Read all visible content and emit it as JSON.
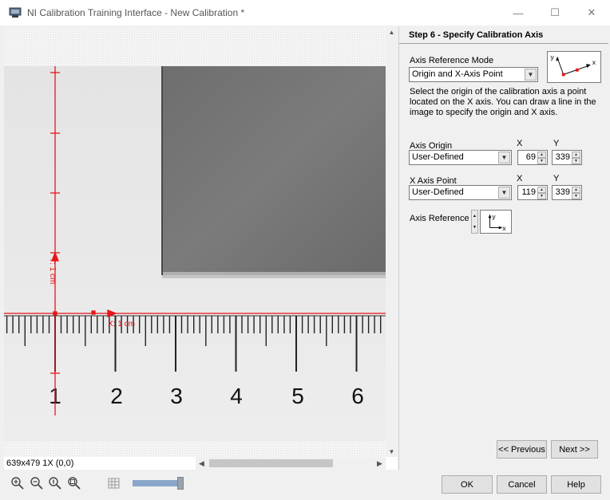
{
  "window": {
    "title": "NI Calibration Training Interface - New Calibration *",
    "minimize_glyph": "—",
    "maximize_glyph": "☐",
    "close_glyph": "✕"
  },
  "viewer": {
    "ruler_labels": [
      "1",
      "2",
      "3",
      "4",
      "5",
      "6"
    ],
    "y_axis_label": "Y: 1 cm",
    "x_axis_label": "X: 1 cm",
    "status": "639x479 1X   (0,0)",
    "axis_color": "#e8151b"
  },
  "panel": {
    "header": "Step 6 - Specify Calibration Axis",
    "axis_reference_mode_label": "Axis Reference Mode",
    "axis_reference_mode_value": "Origin and X-Axis Point",
    "description": "Select the origin of the calibration axis a point located on the X axis. You can draw a line in the image to specify the origin and X axis.",
    "axis_origin": {
      "label": "Axis Origin",
      "mode": "User-Defined",
      "x_header": "X",
      "y_header": "Y",
      "x": "69",
      "y": "339"
    },
    "x_axis_point": {
      "label": "X Axis Point",
      "mode": "User-Defined",
      "x_header": "X",
      "y_header": "Y",
      "x": "119",
      "y": "339"
    },
    "axis_reference_label": "Axis Reference",
    "preview_x": "x",
    "preview_y": "y",
    "prev_button": "<< Previous",
    "next_button": "Next >>"
  },
  "footer": {
    "ok": "OK",
    "cancel": "Cancel",
    "help": "Help",
    "zoom_slider_level": 0.85
  }
}
